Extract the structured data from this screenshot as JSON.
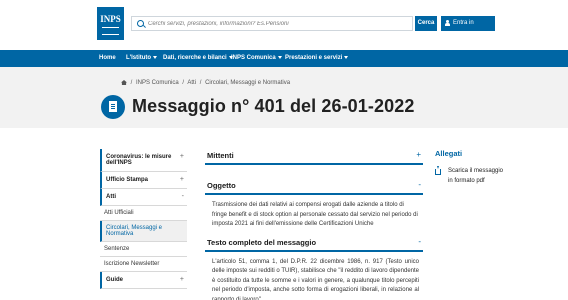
{
  "header": {
    "logo_text": "INPS",
    "search_placeholder": "Cerchi servizi, prestazioni, informazioni? Es.Pensioni",
    "search_button": "Cerca",
    "mypage_button": "Entra in MyINPS"
  },
  "nav": {
    "items": [
      {
        "label": "Home",
        "has_menu": false
      },
      {
        "label": "L'Istituto",
        "has_menu": true
      },
      {
        "label": "Dati, ricerche e bilanci",
        "has_menu": true
      },
      {
        "label": "INPS Comunica",
        "has_menu": true
      },
      {
        "label": "Prestazioni e servizi",
        "has_menu": true
      }
    ]
  },
  "breadcrumb": {
    "items": [
      "INPS Comunica",
      "Atti",
      "Circolari, Messaggi e Normativa"
    ]
  },
  "page": {
    "title": "Messaggio n° 401 del 26-01-2022"
  },
  "sidebar": {
    "coronavirus": "Coronavirus: le misure dell'INPS",
    "ufficio_stampa": "Ufficio Stampa",
    "atti": "Atti",
    "atti_ufficiali": "Atti Ufficiali",
    "circolari": "Circolari, Messaggi e Normativa",
    "sentenze": "Sentenze",
    "newsletter": "Iscrizione Newsletter",
    "guide": "Guide",
    "plus": "+",
    "minus": "-"
  },
  "main": {
    "mittenti_title": "Mittenti",
    "oggetto_title": "Oggetto",
    "oggetto_text": "Trasmissione dei dati relativi ai compensi erogati dalle aziende a titolo di fringe benefit e di stock option al personale cessato dal servizio nel periodo di imposta 2021 ai fini dell'emissione delle Certificazioni Uniche",
    "testo_title": "Testo completo del messaggio",
    "testo_text": "L'articolo 51, comma 1, del D.P.R. 22 dicembre 1986, n. 917 (Testo unico delle imposte sui redditi o TUIR), stabilisce che \"il reddito di lavoro dipendente è costituito da tutte le somme e i valori in genere, a qualunque titolo percepiti nel periodo d'imposta, anche sotto forma di erogazioni liberali, in relazione al rapporto di lavoro\".",
    "plus": "+",
    "minus": "-"
  },
  "right": {
    "title": "Allegati",
    "download_label": "Scarica il messaggio in formato pdf"
  },
  "colors": {
    "brand_blue": "#0066a4",
    "title_band": "#f2f2f2"
  }
}
